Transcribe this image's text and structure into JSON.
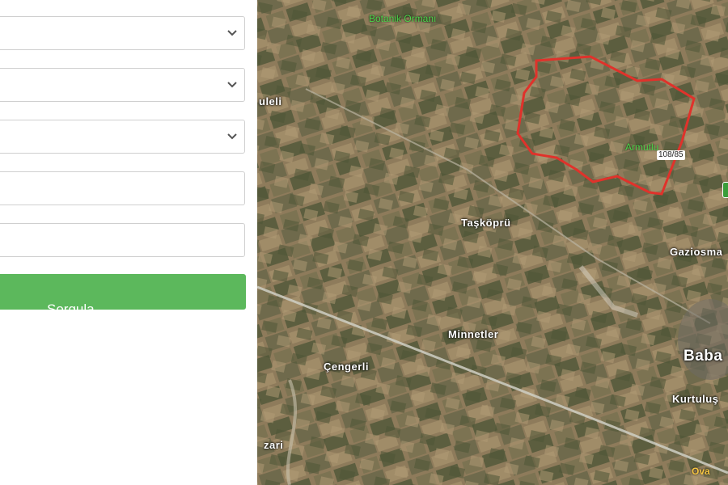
{
  "form": {
    "select_1": "",
    "select_2": "",
    "select_3": "",
    "input_1": "",
    "input_2": "",
    "submit_label": "Sorgula"
  },
  "map": {
    "labels": {
      "botanic": "Botanik Ormanı",
      "uleli": "uleli",
      "armutlu": "Armutlu",
      "taskopru": "Taşköprü",
      "gaziosman": "Gaziosma",
      "minnetler": "Minnetler",
      "cengerli": "Çengerli",
      "baba": "Baba",
      "kurtulus": "Kurtuluş",
      "zari": "zari",
      "ova": "Ova"
    },
    "parcel_number": "108/85",
    "highlight_color": "#e0322b"
  }
}
